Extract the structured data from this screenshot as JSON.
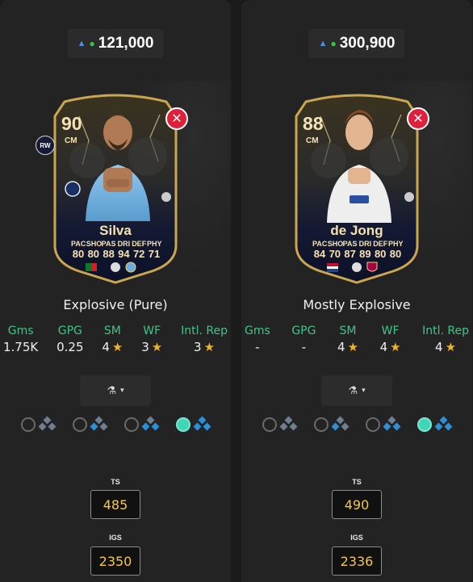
{
  "comparison": [
    {
      "price": "121,000",
      "card": {
        "rating": "90",
        "position": "CM",
        "alt_position": "RW",
        "name": "Silva",
        "stat_labels": [
          "PAC",
          "SHO",
          "PAS",
          "DRI",
          "DEF",
          "PHY"
        ],
        "stat_values": [
          "80",
          "80",
          "88",
          "94",
          "72",
          "71"
        ]
      },
      "playstyle": "Explosive (Pure)",
      "stats": [
        {
          "label": "Gms",
          "value": "1.75K",
          "star": false
        },
        {
          "label": "GPG",
          "value": "0.25",
          "star": false
        },
        {
          "label": "SM",
          "value": "4",
          "star": true
        },
        {
          "label": "WF",
          "value": "3",
          "star": true
        },
        {
          "label": "Intl. Rep",
          "value": "3",
          "star": true
        }
      ],
      "ts_label": "TS",
      "ts_value": "485",
      "igs_label": "IGS",
      "igs_value": "2350"
    },
    {
      "price": "300,900",
      "card": {
        "rating": "88",
        "position": "CM",
        "alt_position": "",
        "name": "de Jong",
        "stat_labels": [
          "PAC",
          "SHO",
          "PAS",
          "DRI",
          "DEF",
          "PHY"
        ],
        "stat_values": [
          "84",
          "70",
          "87",
          "89",
          "80",
          "80"
        ]
      },
      "playstyle": "Mostly Explosive",
      "stats": [
        {
          "label": "Gms",
          "value": "-",
          "star": false
        },
        {
          "label": "GPG",
          "value": "-",
          "star": false
        },
        {
          "label": "SM",
          "value": "4",
          "star": true
        },
        {
          "label": "WF",
          "value": "4",
          "star": true
        },
        {
          "label": "Intl. Rep",
          "value": "4",
          "star": true
        }
      ],
      "ts_label": "TS",
      "ts_value": "490",
      "igs_label": "IGS",
      "igs_value": "2336"
    }
  ],
  "icons": {
    "platform_ps": "playstation-icon",
    "platform_xbox": "xbox-icon",
    "remove": "close-icon",
    "chemistry": "flask-icon",
    "dropdown": "caret-down-icon",
    "star": "star-icon"
  },
  "colors": {
    "accent_green": "#41c48a",
    "star": "#f0b429",
    "rating_value": "#f2c94c",
    "remove": "#e0203a",
    "selected_chem": "#3fd6b8"
  },
  "chem_options_selected_index": 3
}
